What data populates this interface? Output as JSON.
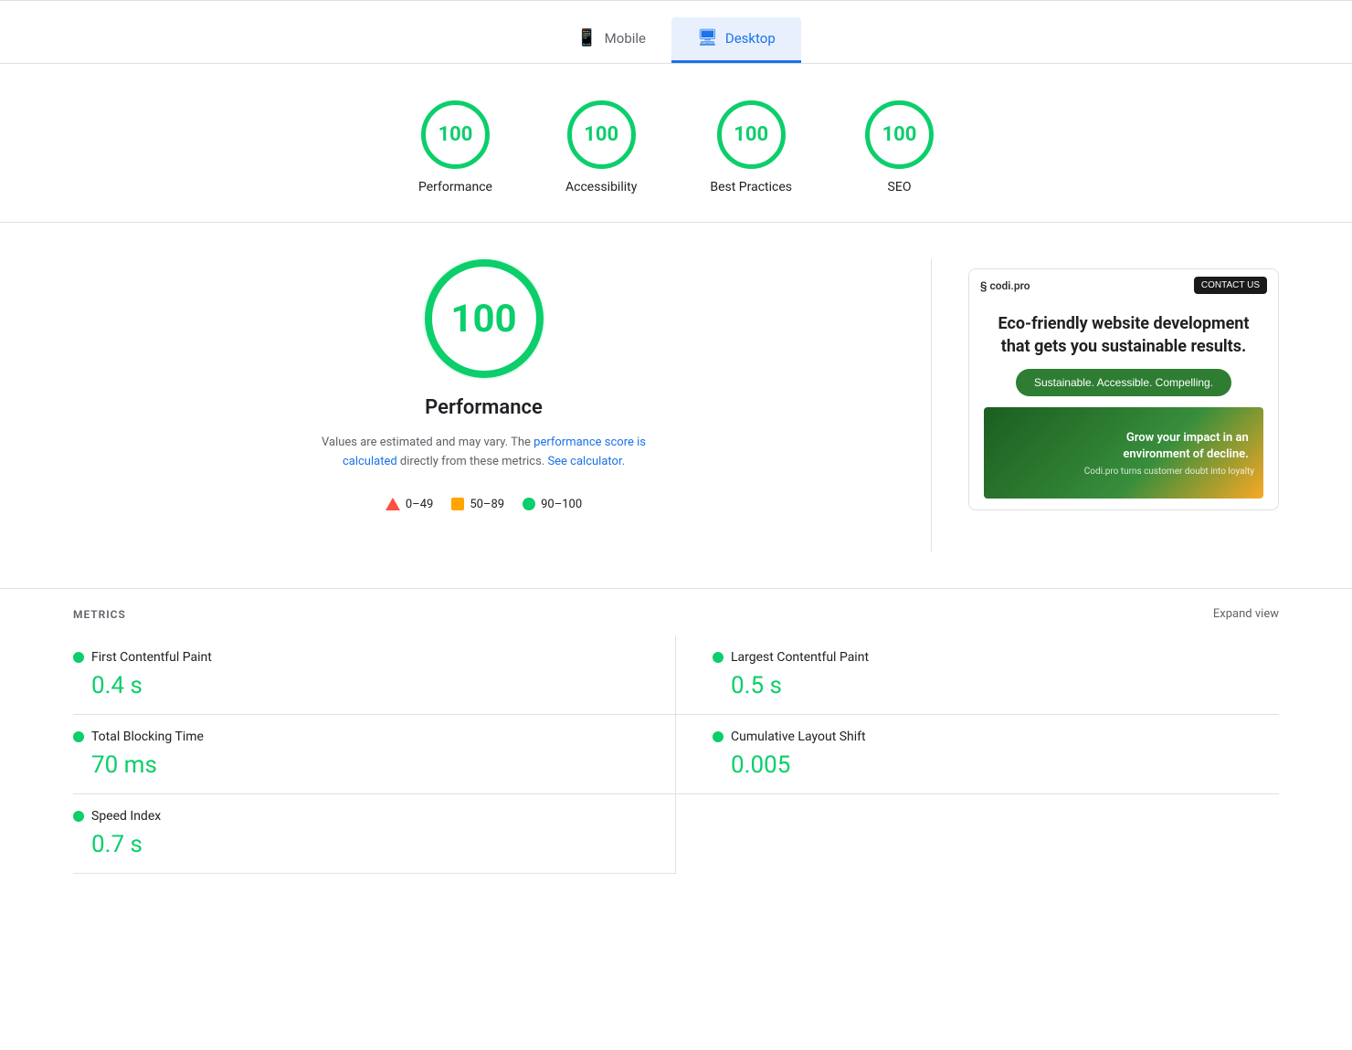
{
  "tabs": [
    {
      "id": "mobile",
      "label": "Mobile",
      "icon": "📱",
      "active": false
    },
    {
      "id": "desktop",
      "label": "Desktop",
      "icon": "🖥",
      "active": true
    }
  ],
  "scores": [
    {
      "id": "performance",
      "value": "100",
      "label": "Performance"
    },
    {
      "id": "accessibility",
      "value": "100",
      "label": "Accessibility"
    },
    {
      "id": "best-practices",
      "value": "100",
      "label": "Best Practices"
    },
    {
      "id": "seo",
      "value": "100",
      "label": "SEO"
    }
  ],
  "main_score": {
    "value": "100",
    "title": "Performance",
    "description_prefix": "Values are estimated and may vary. The ",
    "description_link1": "performance score is calculated",
    "description_middle": " directly from these metrics. ",
    "description_link2": "See calculator.",
    "legend": [
      {
        "type": "triangle",
        "range": "0–49"
      },
      {
        "type": "square",
        "range": "50–89"
      },
      {
        "type": "circle",
        "range": "90–100"
      }
    ]
  },
  "ad": {
    "logo": "§ codi.pro",
    "contact_btn": "CONTACT US",
    "title": "Eco-friendly website development that gets you sustainable results.",
    "green_btn": "Sustainable. Accessible. Compelling.",
    "image_text": "Grow your impact in an environment of decline.",
    "image_subtext": "Codi.pro turns customer doubt into loyalty"
  },
  "metrics": {
    "section_title": "METRICS",
    "expand_label": "Expand view",
    "items": [
      {
        "id": "fcp",
        "name": "First Contentful Paint",
        "value": "0.4 s",
        "color": "#0cce6b"
      },
      {
        "id": "lcp",
        "name": "Largest Contentful Paint",
        "value": "0.5 s",
        "color": "#0cce6b"
      },
      {
        "id": "tbt",
        "name": "Total Blocking Time",
        "value": "70 ms",
        "color": "#0cce6b"
      },
      {
        "id": "cls",
        "name": "Cumulative Layout Shift",
        "value": "0.005",
        "color": "#0cce6b"
      },
      {
        "id": "si",
        "name": "Speed Index",
        "value": "0.7 s",
        "color": "#0cce6b"
      }
    ]
  }
}
